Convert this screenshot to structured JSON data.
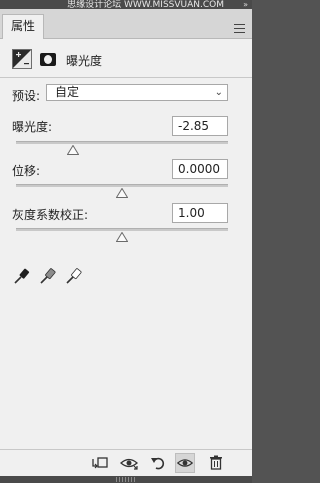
{
  "watermark": "思缘设计论坛 WWW.MISSVUAN.COM",
  "window": {
    "collapse_glyph": "»",
    "tab_label": "属性"
  },
  "header": {
    "title": "曝光度",
    "icons": [
      "exposure-adjustment-icon",
      "layer-mask-icon"
    ]
  },
  "preset": {
    "label": "预设:",
    "value": "自定"
  },
  "sliders": [
    {
      "label": "曝光度:",
      "value": "-2.85",
      "position": 0.27
    },
    {
      "label": "位移:",
      "value": "0.0000",
      "position": 0.5
    },
    {
      "label": "灰度系数校正:",
      "value": "1.00",
      "position": 0.5
    }
  ],
  "eyedroppers": [
    "black-point-eyedropper-icon",
    "gray-point-eyedropper-icon",
    "white-point-eyedropper-icon"
  ],
  "toolbar": {
    "icons": [
      "clip-to-layer-icon",
      "view-previous-state-icon",
      "reset-icon",
      "visibility-icon",
      "delete-icon"
    ]
  },
  "colors": {
    "panel_bg": "#f0f0f0",
    "chrome_dark": "#4a4a4a"
  }
}
